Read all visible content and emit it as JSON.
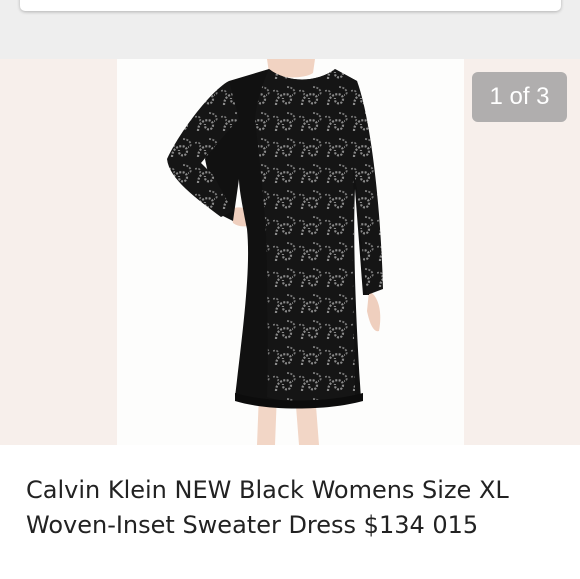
{
  "listing": {
    "image_counter": "1 of 3",
    "title": "Calvin Klein NEW Black Womens Size XL Woven-Inset Sweater Dress $134 015"
  },
  "colors": {
    "top_bar": "#eeeeee",
    "photo_background": "#f7efeb",
    "counter_badge": "#a0a0a0",
    "dress": "#111111",
    "pattern": "#8a8a8a",
    "title_text": "#222222"
  },
  "icons": {
    "product_photo": "black-long-sleeve-sweater-dress"
  }
}
